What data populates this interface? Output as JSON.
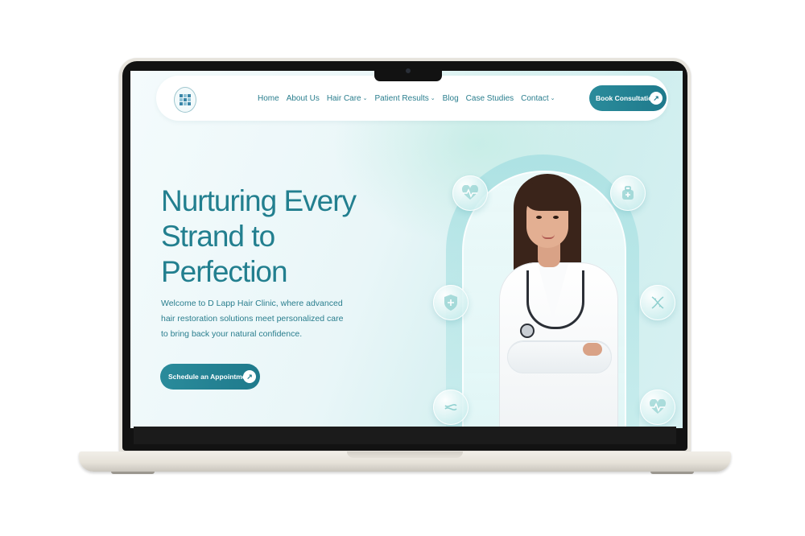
{
  "nav": {
    "items": [
      {
        "label": "Home",
        "has_dropdown": false
      },
      {
        "label": "About Us",
        "has_dropdown": false
      },
      {
        "label": "Hair Care",
        "has_dropdown": true
      },
      {
        "label": "Patient Results",
        "has_dropdown": true
      },
      {
        "label": "Blog",
        "has_dropdown": false
      },
      {
        "label": "Case Studies",
        "has_dropdown": false
      },
      {
        "label": "Contact",
        "has_dropdown": true
      }
    ],
    "cta_label": "Book Consultation"
  },
  "hero": {
    "title_lines": [
      "Nurturing Every",
      "Strand to",
      "Perfection"
    ],
    "description": "Welcome to D Lapp Hair Clinic, where advanced hair restoration solutions meet personalized care to bring back your natural confidence.",
    "cta_label": "Schedule an Appointment"
  },
  "floating_icons": [
    "heart-pulse-icon",
    "medicine-bag-icon",
    "shield-plus-icon",
    "dna-icon",
    "dna-icon",
    "heart-pulse-icon"
  ],
  "colors": {
    "brand": "#227f8f",
    "button": "#1f7a8c",
    "accent_light": "#a8e0e2"
  }
}
